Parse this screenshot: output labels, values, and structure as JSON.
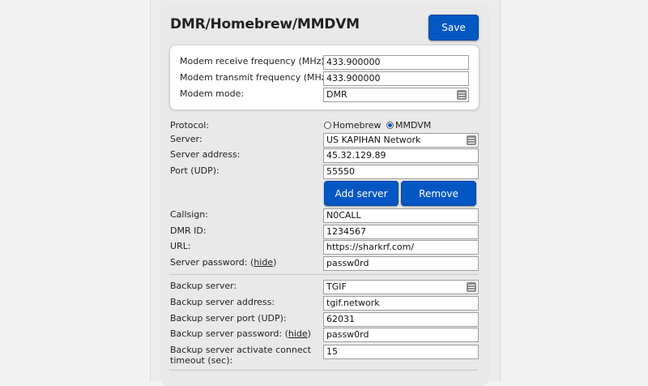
{
  "title": "DMR/Homebrew/MMDVM",
  "save_label": "Save",
  "modem": {
    "rx_label": "Modem receive frequency (MHz):",
    "rx_value": "433.900000",
    "tx_label": "Modem transmit frequency (MHz):",
    "tx_value": "433.900000",
    "mode_label": "Modem mode:",
    "mode_value": "DMR"
  },
  "protocol": {
    "label": "Protocol:",
    "options": [
      "Homebrew",
      "MMDVM"
    ],
    "selected": "MMDVM"
  },
  "server": {
    "label": "Server:",
    "value": "US KAPIHAN Network",
    "address_label": "Server address:",
    "address_value": "45.32.129.89",
    "port_label": "Port (UDP):",
    "port_value": "55550",
    "add_label": "Add server",
    "remove_label": "Remove"
  },
  "account": {
    "callsign_label": "Callsign:",
    "callsign_value": "N0CALL",
    "dmrid_label": "DMR ID:",
    "dmrid_value": "1234567",
    "url_label": "URL:",
    "url_value": "https://sharkrf.com/",
    "password_label": "Server password:",
    "password_toggle": "hide",
    "password_value": "passw0rd"
  },
  "backup": {
    "server_label": "Backup server:",
    "server_value": "TGIF",
    "address_label": "Backup server address:",
    "address_value": "tgif.network",
    "port_label": "Backup server port (UDP):",
    "port_value": "62031",
    "password_label": "Backup server password:",
    "password_toggle": "hide",
    "password_value": "passw0rd",
    "timeout_label_1": "Backup server activate connect",
    "timeout_label_2": "timeout (sec):",
    "timeout_value": "15"
  },
  "colors": {
    "accent": "#0257c3",
    "panel": "#e9e9e9",
    "page": "#f3f3f3"
  }
}
